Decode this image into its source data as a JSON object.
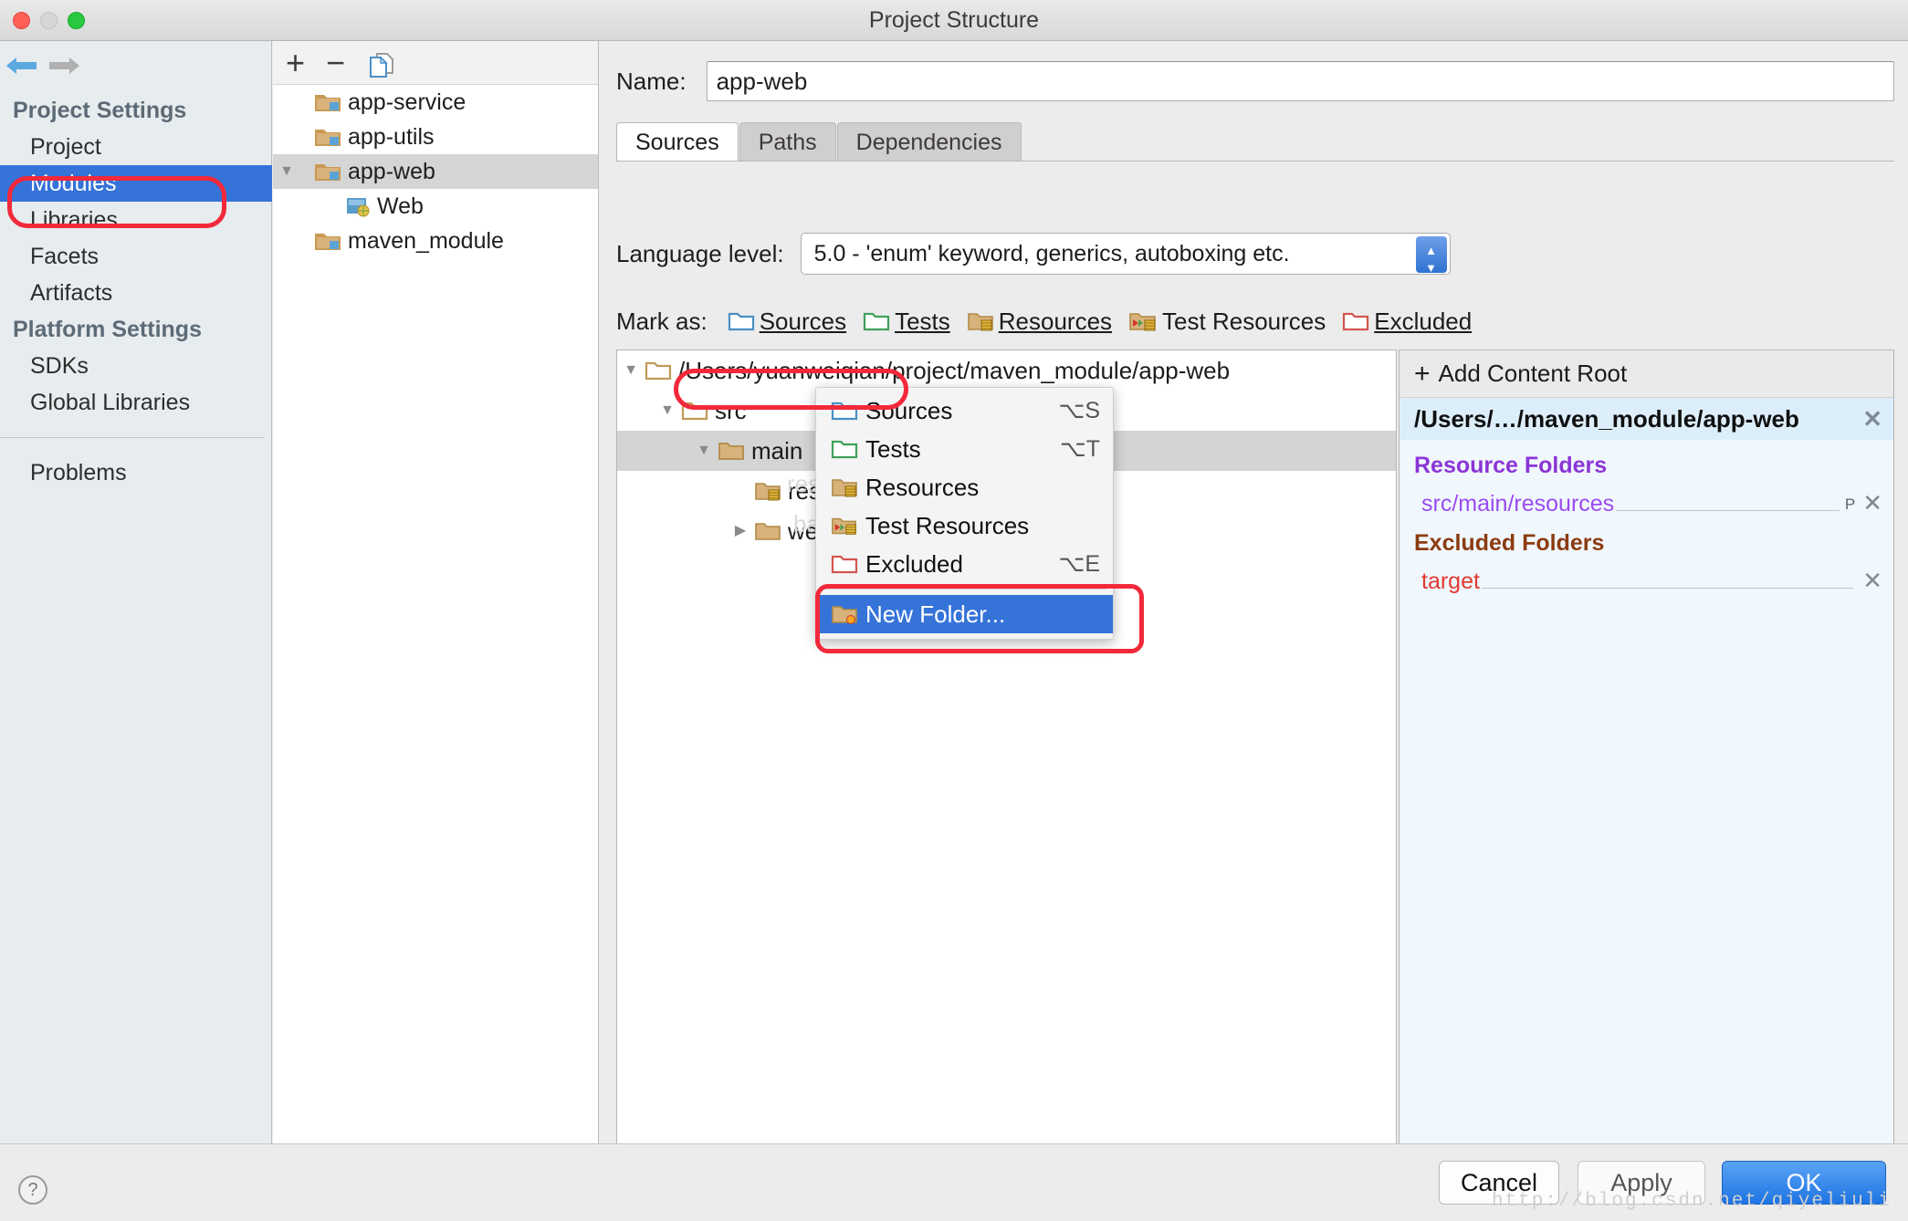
{
  "window": {
    "title": "Project Structure",
    "traffic_lights": [
      "close",
      "minimize",
      "zoom"
    ]
  },
  "sidebar": {
    "nav_back_icon": "back-arrow-icon",
    "nav_forward_icon": "forward-arrow-icon",
    "groups": [
      {
        "title": "Project Settings",
        "items": [
          {
            "label": "Project",
            "selected": false
          },
          {
            "label": "Modules",
            "selected": true
          },
          {
            "label": "Libraries",
            "selected": false
          },
          {
            "label": "Facets",
            "selected": false
          },
          {
            "label": "Artifacts",
            "selected": false
          }
        ]
      },
      {
        "title": "Platform Settings",
        "items": [
          {
            "label": "SDKs",
            "selected": false
          },
          {
            "label": "Global Libraries",
            "selected": false
          }
        ]
      }
    ],
    "footer_items": [
      {
        "label": "Problems",
        "selected": false
      }
    ],
    "help_label": "?"
  },
  "modules_panel": {
    "toolbar": {
      "add_label": "+",
      "remove_label": "−",
      "copy_icon": "copy-icon"
    },
    "tree": [
      {
        "label": "app-service",
        "icon": "module-folder-icon",
        "depth": 1,
        "twisty": "",
        "selected": false
      },
      {
        "label": "app-utils",
        "icon": "module-folder-icon",
        "depth": 1,
        "twisty": "",
        "selected": false
      },
      {
        "label": "app-web",
        "icon": "module-folder-icon",
        "depth": 1,
        "twisty": "▼",
        "selected": true
      },
      {
        "label": "Web",
        "icon": "web-facet-icon",
        "depth": 2,
        "twisty": "",
        "selected": false
      },
      {
        "label": "maven_module",
        "icon": "module-folder-icon",
        "depth": 1,
        "twisty": "",
        "selected": false
      }
    ]
  },
  "main": {
    "name_label": "Name:",
    "name_value": "app-web",
    "tabs": [
      {
        "label": "Sources",
        "active": true
      },
      {
        "label": "Paths",
        "active": false
      },
      {
        "label": "Dependencies",
        "active": false
      }
    ],
    "language_level_label": "Language level:",
    "language_level_value": "5.0 - 'enum' keyword, generics, autoboxing etc.",
    "mark_as_label": "Mark as:",
    "mark_as_buttons": [
      {
        "label": "Sources",
        "mnemonic": "S",
        "icon": "blue-folder-icon"
      },
      {
        "label": "Tests",
        "mnemonic": "T",
        "icon": "green-folder-icon"
      },
      {
        "label": "Resources",
        "mnemonic": "R",
        "icon": "resources-folder-icon"
      },
      {
        "label": "Test Resources",
        "mnemonic": "",
        "icon": "test-resources-folder-icon"
      },
      {
        "label": "Excluded",
        "mnemonic": "E",
        "icon": "red-folder-icon"
      }
    ],
    "source_tree": [
      {
        "label": "/Users/yuanweiqian/project/maven_module/app-web",
        "depth": 0,
        "twisty": "▼",
        "icon": "folder-icon",
        "selected": false
      },
      {
        "label": "src",
        "depth": 1,
        "twisty": "▼",
        "icon": "folder-icon",
        "selected": false
      },
      {
        "label": "main",
        "depth": 2,
        "twisty": "▼",
        "icon": "folder-icon",
        "selected": true
      },
      {
        "label": "resources",
        "depth": 3,
        "twisty": "",
        "icon": "resources-folder-icon",
        "selected": false
      },
      {
        "label": "webapp",
        "depth": 3,
        "twisty": "▶",
        "icon": "folder-icon",
        "selected": false
      }
    ]
  },
  "context_menu": {
    "items": [
      {
        "label": "Sources",
        "accel": "⌥S",
        "icon": "blue-folder-icon",
        "highlighted": false
      },
      {
        "label": "Tests",
        "accel": "⌥T",
        "icon": "green-folder-icon",
        "highlighted": false
      },
      {
        "label": "Resources",
        "accel": "",
        "icon": "resources-folder-icon",
        "highlighted": false
      },
      {
        "label": "Test Resources",
        "accel": "",
        "icon": "test-resources-folder-icon",
        "highlighted": false
      },
      {
        "label": "Excluded",
        "accel": "⌥E",
        "icon": "red-folder-icon",
        "highlighted": false
      },
      {
        "separator": true
      },
      {
        "label": "New Folder...",
        "accel": "",
        "icon": "new-folder-icon",
        "highlighted": true
      }
    ]
  },
  "roots_panel": {
    "add_content_root_label": "Add Content Root",
    "add_icon": "plus-icon",
    "content_root": "/Users/…/maven_module/app-web",
    "content_root_remove_icon": "close-icon",
    "groups": [
      {
        "title": "Resource Folders",
        "color": "#8b35d6",
        "entries": [
          {
            "path": "src/main/resources",
            "badge": "P",
            "remove_icon": "close-icon"
          }
        ]
      },
      {
        "title": "Excluded Folders",
        "color": "#8c3b10",
        "entries": [
          {
            "path": "target",
            "badge": "",
            "remove_icon": "close-icon"
          }
        ]
      }
    ]
  },
  "annotations": {
    "highlight_color": "#f2293a",
    "boxes": [
      "modules-sidebar-item",
      "main-tree-row",
      "new-folder-menu-item"
    ]
  },
  "footer": {
    "cancel_label": "Cancel",
    "apply_label": "Apply",
    "ok_label": "OK"
  },
  "watermark": "http://blog.csdn.net/qiyeliuli",
  "ghost_text": {
    "resources": "resources",
    "webapp": "bapp"
  }
}
